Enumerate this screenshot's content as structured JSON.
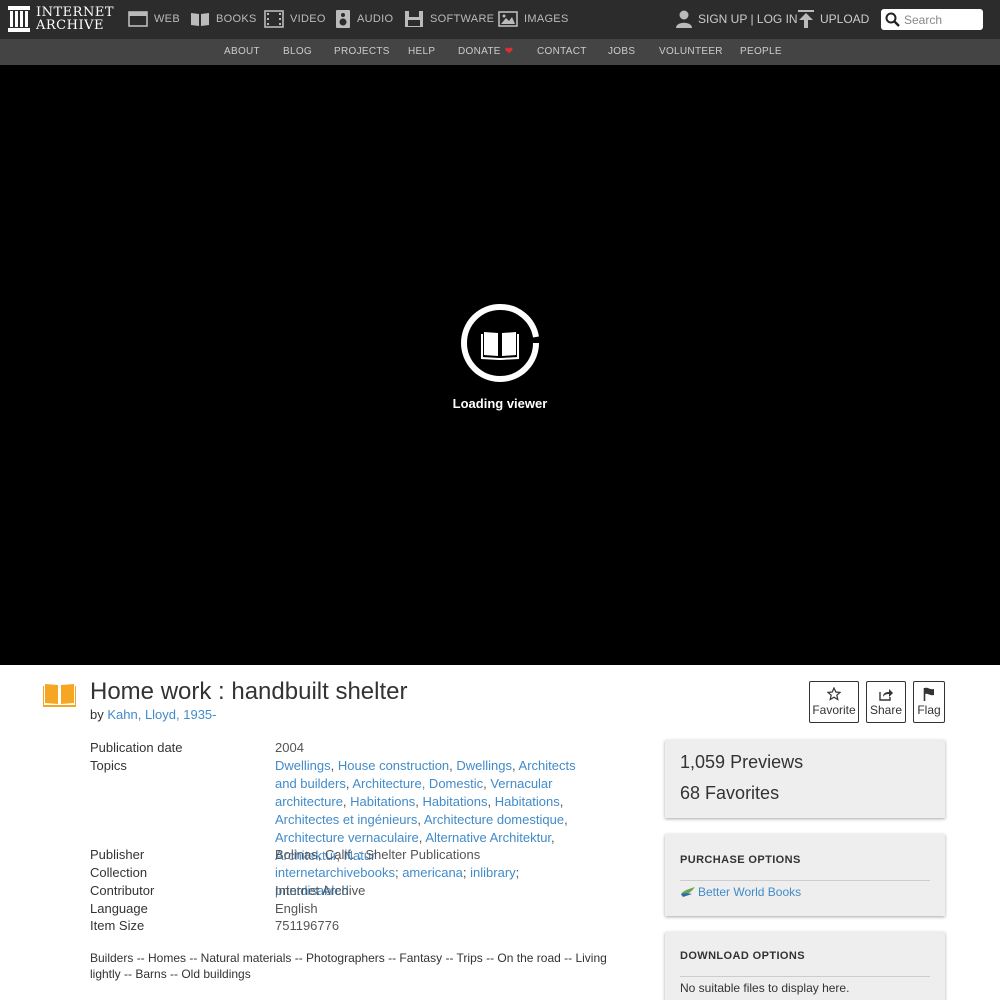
{
  "topnav": {
    "logo_line1": "INTERNET",
    "logo_line2": "ARCHIVE",
    "items": [
      {
        "label": "WEB",
        "icon": "web-icon"
      },
      {
        "label": "BOOKS",
        "icon": "books-icon"
      },
      {
        "label": "VIDEO",
        "icon": "video-icon"
      },
      {
        "label": "AUDIO",
        "icon": "audio-icon"
      },
      {
        "label": "SOFTWARE",
        "icon": "software-icon"
      },
      {
        "label": "IMAGES",
        "icon": "images-icon"
      }
    ],
    "signup": "SIGN UP | LOG IN",
    "upload": "UPLOAD",
    "search_placeholder": "Search"
  },
  "subnav": {
    "items": [
      "ABOUT",
      "BLOG",
      "PROJECTS",
      "HELP",
      "DONATE",
      "CONTACT",
      "JOBS",
      "VOLUNTEER",
      "PEOPLE"
    ]
  },
  "viewer": {
    "loading_text": "Loading viewer"
  },
  "item": {
    "title": "Home work : handbuilt shelter",
    "by_prefix": "by",
    "author": "Kahn, Lloyd, 1935-"
  },
  "actions": {
    "favorite": "Favorite",
    "share": "Share",
    "flag": "Flag"
  },
  "metadata": {
    "publication_date_label": "Publication date",
    "publication_date": "2004",
    "topics_label": "Topics",
    "topics": [
      "Dwellings",
      "House construction",
      "Dwellings",
      "Architects and builders",
      "Architecture, Domestic",
      "Vernacular architecture",
      "Habitations",
      "Habitations",
      "Habitations",
      "Architectes et ingénieurs",
      "Architecture domestique",
      "Architecture vernaculaire",
      "Alternative Architektur",
      "Architektur",
      "Natur"
    ],
    "publisher_label": "Publisher",
    "publisher": "Bolinas, Calif. : Shelter Publications",
    "collection_label": "Collection",
    "collections": [
      "internetarchivebooks",
      "americana",
      "inlibrary",
      "printdisabled"
    ],
    "contributor_label": "Contributor",
    "contributor": "Internet Archive",
    "language_label": "Language",
    "language": "English",
    "item_size_label": "Item Size",
    "item_size": "751196776"
  },
  "description": "Builders -- Homes -- Natural materials -- Photographers -- Fantasy -- Trips -- On the road -- Living lightly -- Barns -- Old buildings",
  "stats": {
    "previews_count": "1,059",
    "previews_label": "Previews",
    "favorites_count": "68",
    "favorites_label": "Favorites"
  },
  "purchase": {
    "heading": "PURCHASE OPTIONS",
    "seller": "Better World Books"
  },
  "download": {
    "heading": "DOWNLOAD OPTIONS",
    "empty": "No suitable files to display here."
  },
  "colors": {
    "link": "#428bca",
    "nav_bg": "#2c2c2c",
    "subnav_bg": "#444444",
    "book_icon": "#f5a623",
    "heart": "#e03030"
  }
}
